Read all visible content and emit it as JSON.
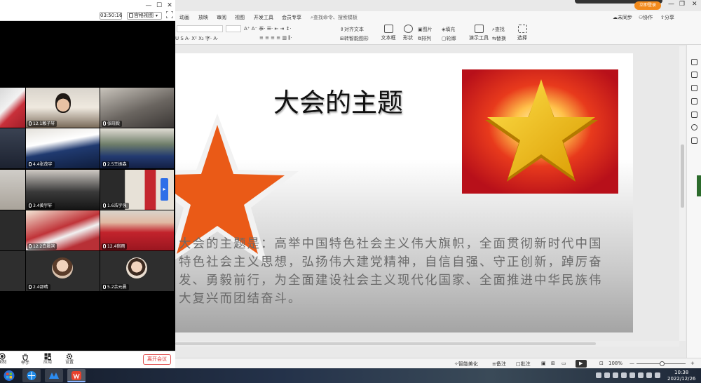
{
  "meeting": {
    "timer": "03:50:16",
    "view_mode": "宫格视图",
    "participants": [
      {
        "name": ""
      },
      {
        "name": "12.1賴子轩"
      },
      {
        "name": "张晓毅"
      },
      {
        "name": ""
      },
      {
        "name": "4.4张茂宇"
      },
      {
        "name": "2.5王振森"
      },
      {
        "name": ""
      },
      {
        "name": "3.4黄宇轩"
      },
      {
        "name": "1.6浩宇强"
      },
      {
        "name": ""
      },
      {
        "name": "12.2白晨滨"
      },
      {
        "name": "12.4宿雨"
      },
      {
        "name": ""
      },
      {
        "name": "2.4邵晴"
      },
      {
        "name": "5.2余元晨"
      }
    ],
    "toolbar": [
      {
        "label": "录制",
        "icon": "record-icon"
      },
      {
        "label": "举手",
        "icon": "raise-hand-icon"
      },
      {
        "label": "应用",
        "icon": "apps-icon"
      },
      {
        "label": "设置",
        "icon": "settings-icon"
      }
    ],
    "leave_button": "离开会议"
  },
  "wps": {
    "menu_tabs": [
      "动画",
      "放映",
      "审阅",
      "视图",
      "开发工具",
      "会员专享"
    ],
    "search_placeholder": "查找命令、搜索模板",
    "badge": "立即登录",
    "right_actions": {
      "sync": "未同步",
      "collab": "协作",
      "share": "分享"
    },
    "ribbon": {
      "align_text": "对齐文本",
      "convert_smartart": "转智能图形",
      "image": "图片",
      "fill": "填充",
      "arrange": "排列",
      "outline": "轮廓",
      "find": "查找",
      "replace": "替换",
      "textbox": "文本框",
      "shape": "形状",
      "slide_tools": "演示工具",
      "select": "选择"
    },
    "slide": {
      "title": "大会的主题",
      "body": "大会的主题是：高举中国特色社会主义伟大旗帜，全面贯彻新时代中国特色社会主义思想，弘扬伟大建党精神，自信自强、守正创新，踔厉奋发、勇毅前行，为全面建设社会主义现代化国家、全面推进中华民族伟大复兴而团结奋斗。"
    },
    "status": {
      "smart_beautify": "智能美化",
      "notes": "备注",
      "comments": "批注",
      "zoom": "108%"
    }
  },
  "taskbar": {
    "time": "10:38",
    "date": "2022/12/26"
  }
}
